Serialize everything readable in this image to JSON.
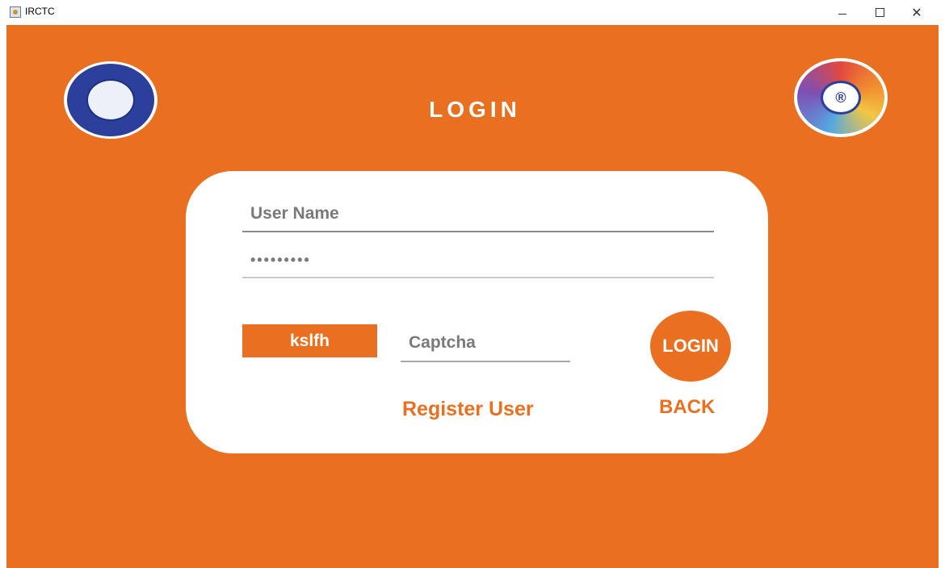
{
  "window": {
    "title": "IRCTC",
    "controls": {
      "minimize": "—",
      "maximize": "☐",
      "close": "✕"
    }
  },
  "header": {
    "title": "LOGIN",
    "left_logo": "indian-railways-logo",
    "right_logo": "irctc-logo"
  },
  "form": {
    "username_placeholder": "User Name",
    "password_value": "•••••••••",
    "captcha_code": "kslfh",
    "captcha_placeholder": "Captcha",
    "login_label": "LOGIN",
    "register_label": "Register User",
    "back_label": "BACK"
  },
  "colors": {
    "accent": "#e97021",
    "card": "#ffffff"
  }
}
